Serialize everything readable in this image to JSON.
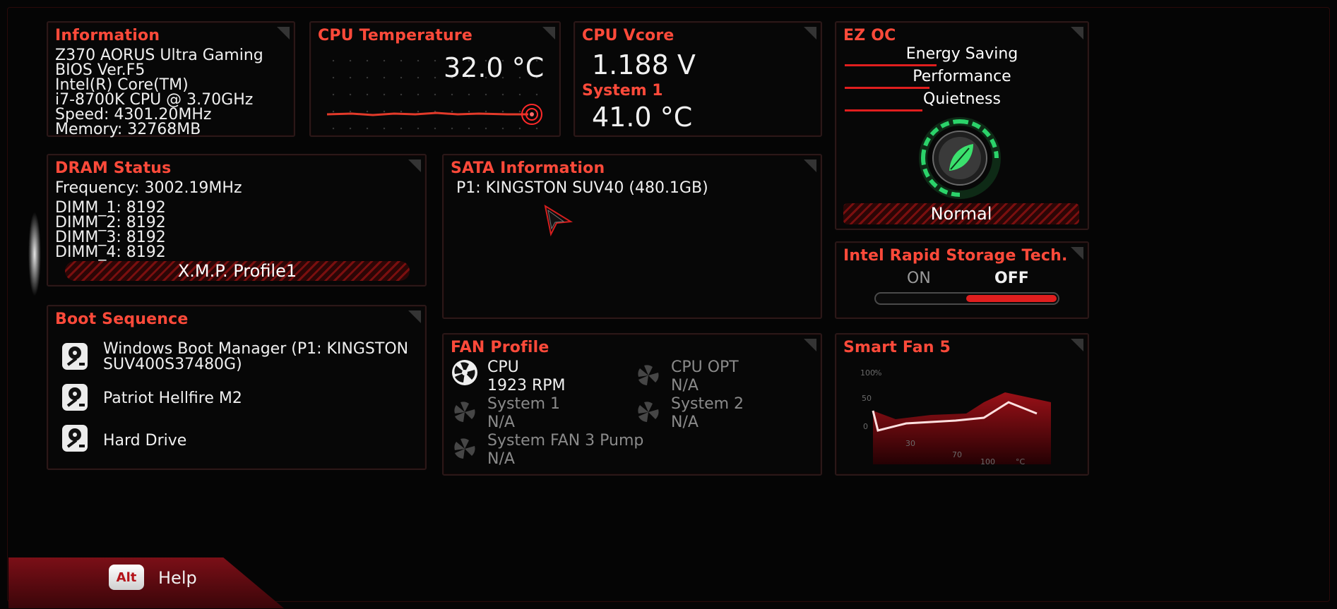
{
  "information": {
    "title": "Information",
    "lines": [
      "Z370 AORUS Ultra Gaming",
      "BIOS Ver.F5",
      "Intel(R) Core(TM)",
      "i7-8700K CPU @ 3.70GHz",
      "Speed: 4301.20MHz",
      "Memory: 32768MB"
    ]
  },
  "cpu_temp": {
    "title": "CPU Temperature",
    "value": "32.0 °C"
  },
  "cpu_vcore": {
    "title": "CPU Vcore",
    "value": "1.188 V",
    "system_label": "System 1",
    "system_value": "41.0 °C"
  },
  "ez_oc": {
    "title": "EZ OC",
    "options": [
      "Energy Saving",
      "Performance",
      "Quietness"
    ],
    "mode": "Normal"
  },
  "dram": {
    "title": "DRAM Status",
    "frequency": "Frequency: 3002.19MHz",
    "dimms": [
      "DIMM_1: 8192",
      "DIMM_2: 8192",
      "DIMM_3: 8192",
      "DIMM_4: 8192"
    ],
    "xmp_label": "X.M.P.  Profile1"
  },
  "sata": {
    "title": "SATA Information",
    "entries": [
      "P1: KINGSTON SUV40 (480.1GB)"
    ]
  },
  "irst": {
    "title": "Intel Rapid Storage Tech.",
    "on": "ON",
    "off": "OFF",
    "state": "OFF"
  },
  "boot": {
    "title": "Boot Sequence",
    "items": [
      {
        "line1": "Windows Boot Manager (P1: KINGSTON",
        "line2": "SUV400S37480G)"
      },
      {
        "line1": "Patriot Hellfire M2",
        "line2": ""
      },
      {
        "line1": "Hard Drive",
        "line2": ""
      }
    ]
  },
  "fan": {
    "title": "FAN Profile",
    "fans": [
      {
        "name": "CPU",
        "value": "1923 RPM",
        "active": true
      },
      {
        "name": "CPU OPT",
        "value": "N/A",
        "active": false
      },
      {
        "name": "System 1",
        "value": "N/A",
        "active": false
      },
      {
        "name": "System 2",
        "value": "N/A",
        "active": false
      },
      {
        "name": "System FAN 3 Pump",
        "value": "N/A",
        "active": false
      }
    ]
  },
  "smart_fan": {
    "title": "Smart Fan 5",
    "y_ticks": [
      "100",
      "%",
      "50",
      "0"
    ],
    "x_ticks": [
      "30",
      "70",
      "100",
      "°C"
    ]
  },
  "help": {
    "key": "Alt",
    "label": "Help"
  },
  "colors": {
    "accent": "#ff4a3a",
    "red": "#e01e1e",
    "green": "#2bd36a"
  }
}
